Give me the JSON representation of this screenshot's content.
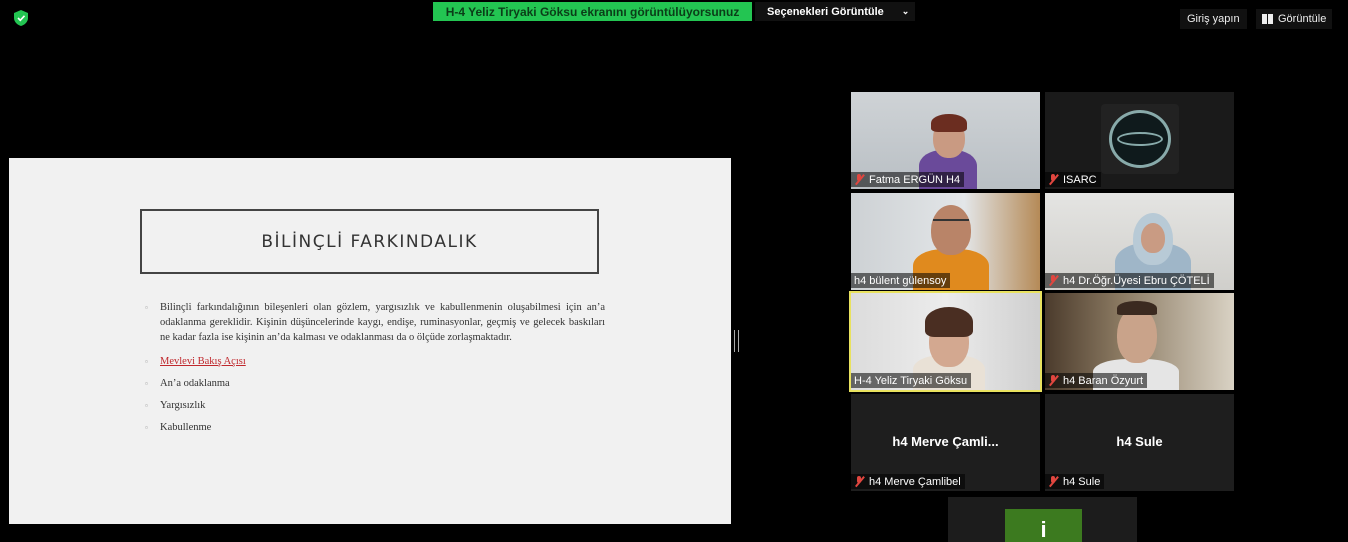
{
  "top_bar": {
    "share_banner": "H-4 Yeliz Tiryaki Göksu ekranını görüntülüyorsunuz",
    "view_options": "Seçenekleri Görüntüle",
    "signin": "Giriş yapın",
    "view": "Görüntüle",
    "colors": {
      "banner": "#23c552",
      "shield": "#23c552"
    }
  },
  "slide": {
    "title": "BİLİNÇLİ FARKINDALIK",
    "bullets": [
      "Bilinçli farkındalığının bileşenleri olan gözlem, yargısızlık ve kabullenmenin oluşabilmesi için an’a odaklanma gereklidir. Kişinin düşüncelerinde kaygı, endişe, ruminasyonlar, geçmiş ve gelecek baskıları ne kadar fazla ise kişinin an’da kalması ve odaklanması da o ölçüde zorlaşmaktadır.",
      "Mevlevi Bakış Açısı",
      "An’a odaklanma",
      "Yargısızlık",
      "Kabullenme"
    ]
  },
  "participants": [
    {
      "name": "Fatma ERGÜN H4",
      "muted": true
    },
    {
      "name": "ISARC",
      "muted": true
    },
    {
      "name": "h4 bülent gülensoy",
      "muted": false
    },
    {
      "name": "h4 Dr.Öğr.Üyesi Ebru ÇÖTELİ",
      "muted": true
    },
    {
      "name": "H-4 Yeliz Tiryaki Göksu",
      "muted": false,
      "active_speaker": true
    },
    {
      "name": "h4 Baran Özyurt",
      "muted": true
    },
    {
      "name": "h4 Merve Çamlibel",
      "display": "h4 Merve Çamli...",
      "muted": true
    },
    {
      "name": "h4 Sule",
      "display": "h4 Sule",
      "muted": true
    }
  ],
  "bottom_avatar": "i"
}
